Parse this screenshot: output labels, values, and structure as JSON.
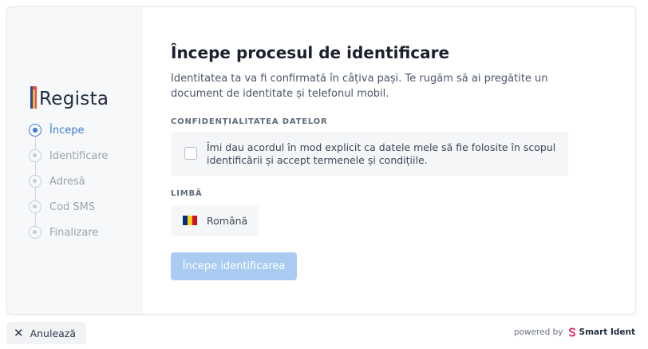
{
  "sidebar": {
    "logo_text": "Regista",
    "steps": [
      {
        "label": "Începe",
        "active": true
      },
      {
        "label": "Identificare",
        "active": false
      },
      {
        "label": "Adresă",
        "active": false
      },
      {
        "label": "Cod SMS",
        "active": false
      },
      {
        "label": "Finalizare",
        "active": false
      }
    ]
  },
  "main": {
    "title": "Începe procesul de identificare",
    "intro": "Identitatea ta va fi confirmată în câțiva pași. Te rugăm să ai pregătite un document de identitate și telefonul mobil.",
    "privacy_label": "CONFIDENȚIALITATEA DATELOR",
    "consent_text": "Îmi dau acordul în mod explicit ca datele mele să fie folosite în scopul identificării și accept termenele și condițiile.",
    "consent_checked": false,
    "language_label": "LIMBĂ",
    "language_value": "Română",
    "start_button": "Începe identificarea"
  },
  "footer": {
    "cancel_label": "Anulează",
    "powered_by": "powered by",
    "brand": "Smart Ident"
  },
  "colors": {
    "accent": "#3a7bd5",
    "button_disabled": "#a9cbf2",
    "sidebar_bg": "#f7f8fa",
    "flag": [
      "#002B7F",
      "#FCD116",
      "#CE1126"
    ]
  },
  "icons": {
    "cancel": "close-icon",
    "brand": "smart-ident-logo-icon"
  }
}
